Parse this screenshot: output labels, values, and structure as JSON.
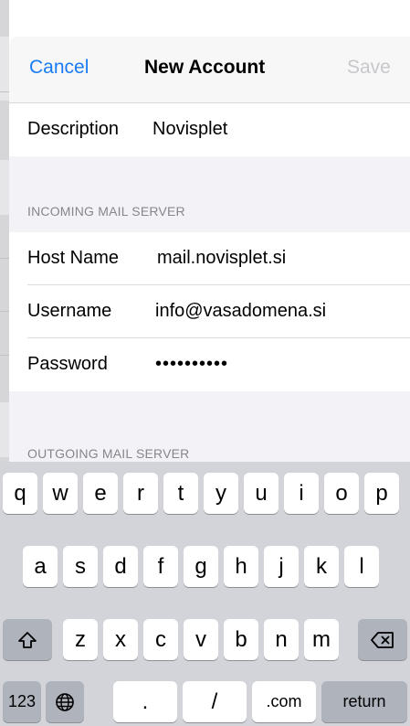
{
  "navbar": {
    "cancel": "Cancel",
    "title": "New Account",
    "save": "Save"
  },
  "description": {
    "label": "Description",
    "value": "Novisplet"
  },
  "incoming": {
    "header": "INCOMING MAIL SERVER",
    "host_label": "Host Name",
    "host_value": "mail.novisplet.si",
    "user_label": "Username",
    "user_value": "info@vasadomena.si",
    "pass_label": "Password",
    "pass_value": "••••••••••"
  },
  "outgoing": {
    "header": "OUTGOING MAIL SERVER"
  },
  "keyboard": {
    "row1": [
      "q",
      "w",
      "e",
      "r",
      "t",
      "y",
      "u",
      "i",
      "o",
      "p"
    ],
    "row2": [
      "a",
      "s",
      "d",
      "f",
      "g",
      "h",
      "j",
      "k",
      "l"
    ],
    "row3": [
      "z",
      "x",
      "c",
      "v",
      "b",
      "n",
      "m"
    ],
    "numbers_key": "123",
    "dot_key": ".",
    "slash_key": "/",
    "dotcom_key": ".com",
    "return_key": "return",
    "shift_icon": "shift-icon",
    "delete_icon": "delete-icon",
    "globe_icon": "globe-icon"
  },
  "colors": {
    "accent": "#1a7cf5",
    "keyboard_bg": "#d2d4d9"
  }
}
